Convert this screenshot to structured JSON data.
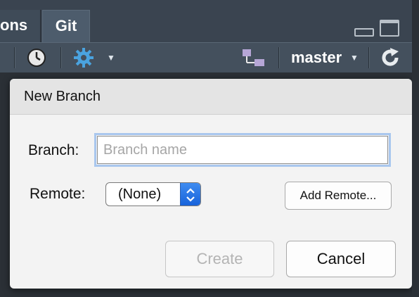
{
  "tabs": [
    {
      "label": "ons",
      "active": false
    },
    {
      "label": "Git",
      "active": true
    }
  ],
  "toolbar": {
    "icons": [
      "history-icon",
      "gear-icon",
      "branch-diagram-icon",
      "refresh-icon"
    ],
    "branch": "master"
  },
  "dialog": {
    "title": "New Branch",
    "branch_label": "Branch:",
    "branch_placeholder": "Branch name",
    "branch_value": "",
    "remote_label": "Remote:",
    "remote_value": "(None)",
    "add_remote_label": "Add Remote...",
    "create_label": "Create",
    "create_enabled": false,
    "cancel_label": "Cancel"
  },
  "colors": {
    "accent": "#1560d9",
    "focus_ring": "#a9c7ee",
    "toolbar": "#44505d"
  }
}
